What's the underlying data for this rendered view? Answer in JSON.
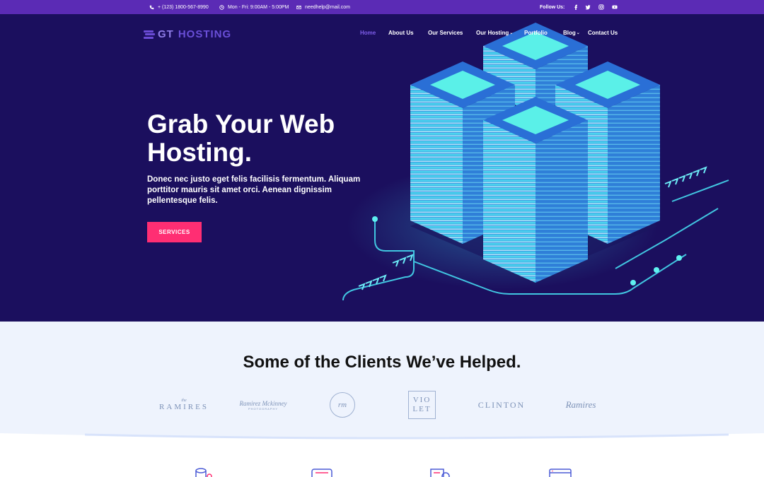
{
  "topbar": {
    "phone": "+ (123) 1800-567-8990",
    "hours": "Mon - Fri: 9:00AM - 5:00PM",
    "email": "needhelp@mail.com",
    "follow_label": "Follow Us:",
    "social": [
      "facebook-icon",
      "twitter-icon",
      "instagram-icon",
      "youtube-icon"
    ]
  },
  "logo": {
    "part1": "GT",
    "part2": "HOSTING"
  },
  "nav": {
    "home": "Home",
    "about": "About Us",
    "services": "Our Services",
    "hosting": "Our Hosting",
    "portfolio": "Portfolio",
    "blog": "Blog",
    "contact": "Contact Us"
  },
  "hero": {
    "headline_line1": "Grab Your Web",
    "headline_line2": "Hosting.",
    "subtext": "Donec nec justo eget felis facilisis fermentum. Aliquam porttitor mauris sit amet orci. Aenean dignissim pellentesque felis.",
    "cta": "SERVICES"
  },
  "clients": {
    "title": "Some of the Clients We’ve Helped.",
    "logos": {
      "ramires_small": "the",
      "ramires": "RAMIRES",
      "mckinney": "Ramirez Mckinney",
      "mckinney_sub": "PHOTOGRAPHY",
      "rm": "rm",
      "violet_1": "VIO",
      "violet_2": "LET",
      "clinton": "CLINTON",
      "ramires_script": "Ramires"
    }
  },
  "colors": {
    "topbar": "#5b2bb5",
    "hero_bg": "#1b0f5e",
    "accent": "#7d5ce8",
    "cta": "#ff2e73",
    "clients_bg": "#eef3fd",
    "server_glow": "#43f0e6"
  }
}
